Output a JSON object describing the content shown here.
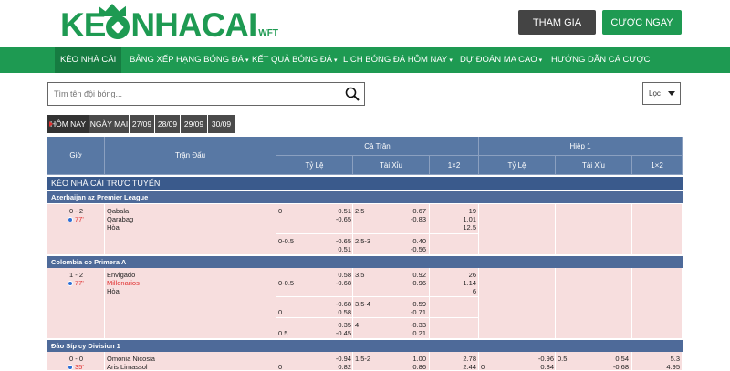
{
  "header": {
    "logo_keo": "KE",
    "logo_nhacai": "NHACAI",
    "logo_wft": "WFT",
    "join_label": "THAM GIA",
    "bet_label": "CƯỢC NGAY"
  },
  "nav": [
    "KÈO NHÀ CÁI",
    "BẢNG XẾP HẠNG BÓNG ĐÁ",
    "KẾT QUẢ BÓNG ĐÁ",
    "LỊCH BÓNG ĐÁ HÔM NAY",
    "DỰ ĐOÁN MA CAO",
    "HƯỚNG DẪN CÁ CƯỢC"
  ],
  "search": {
    "placeholder": "Tìm tên đội bóng..."
  },
  "filter": {
    "label": "Lọc"
  },
  "date_tabs": [
    "HÔM NAY",
    "NGÀY MAI",
    "27/09",
    "28/09",
    "29/09",
    "30/09"
  ],
  "table_head": {
    "time": "Giờ",
    "match": "Trận Đấu",
    "full": "Cả Trận",
    "half": "Hiệp 1",
    "handicap": "Tỷ Lệ",
    "overunder": "Tài Xỉu",
    "x12": "1×2"
  },
  "section_title": "KÈO NHÀ CÁI TRỰC TUYẾN",
  "leagues": [
    {
      "name": "Azerbaijan az Premier League"
    },
    {
      "name": "Colombia co Primera A"
    },
    {
      "name": "Đảo Síp cy Division 1"
    }
  ],
  "matches": [
    {
      "score": "0 - 2",
      "minute": "77'",
      "home": "Qabala",
      "away": "Qarabag",
      "draw": "Hòa",
      "rows": [
        {
          "hdp": "0",
          "hdp2": "",
          "hdp_o1": "0.51",
          "hdp_o2": "-0.65",
          "ou": "2.5",
          "ou_o1": "0.67",
          "ou_o2": "-0.83",
          "x1": "19",
          "x2": "1.01",
          "x3": "12.5"
        },
        {
          "hdp": "0-0.5",
          "hdp2": "",
          "hdp_o1": "-0.65",
          "hdp_o2": "0.51",
          "ou": "2.5-3",
          "ou_o1": "0.40",
          "ou_o2": "-0.56",
          "x1": "",
          "x2": "",
          "x3": ""
        }
      ]
    },
    {
      "score": "1 - 2",
      "minute": "77'",
      "home": "Envigado",
      "away": "Millonarios",
      "draw": "Hòa",
      "rows": [
        {
          "hdp": "",
          "hdp2": "0-0.5",
          "hdp_o1": "0.58",
          "hdp_o2": "-0.68",
          "ou": "3.5",
          "ou_o1": "0.92",
          "ou_o2": "0.96",
          "x1": "26",
          "x2": "1.14",
          "x3": "6"
        },
        {
          "hdp": "",
          "hdp2": "0",
          "hdp_o1": "-0.68",
          "hdp_o2": "0.58",
          "ou": "3.5-4",
          "ou_o1": "0.59",
          "ou_o2": "-0.71",
          "x1": "",
          "x2": "",
          "x3": ""
        },
        {
          "hdp": "",
          "hdp2": "0.5",
          "hdp_o1": "0.35",
          "hdp_o2": "-0.45",
          "ou": "4",
          "ou_o1": "-0.33",
          "ou_o2": "0.21",
          "x1": "",
          "x2": "",
          "x3": ""
        }
      ]
    },
    {
      "score": "0 - 0",
      "minute": "35'",
      "home": "Omonia Nicosia",
      "away": "Aris Limassol",
      "rows": [
        {
          "hdp": "",
          "hdp2": "0",
          "hdp_o1": "-0.94",
          "hdp_o2": "0.82",
          "ou": "1.5-2",
          "ou_o1": "1.00",
          "ou_o2": "0.86",
          "x1": "2.78",
          "x2": "2.44",
          "x3": "",
          "h_hdp2": "0",
          "h_o1": "-0.96",
          "h_o2": "0.84",
          "h_ou": "0.5",
          "h_ou1": "0.54",
          "h_ou2": "-0.68",
          "h_x1": "5.3",
          "h_x2": "4.95"
        }
      ]
    }
  ]
}
